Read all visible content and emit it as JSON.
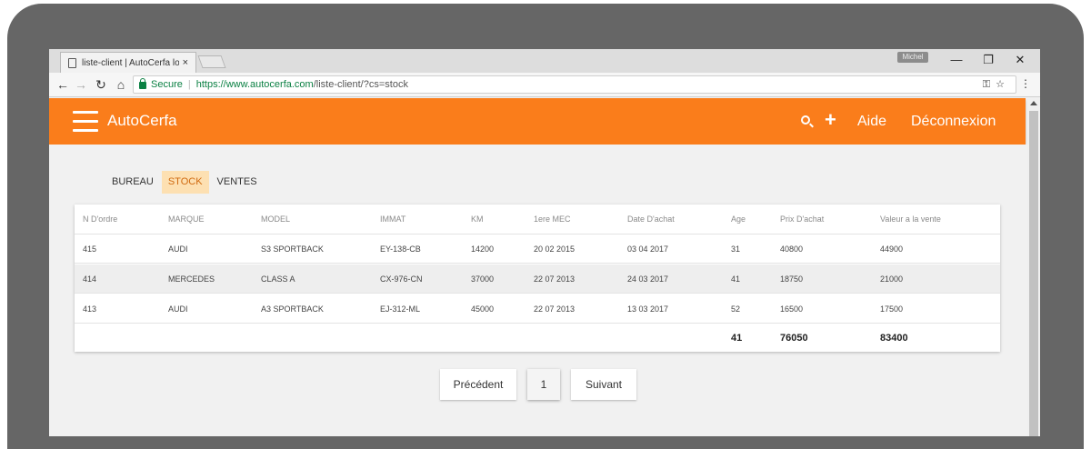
{
  "browser": {
    "tab_title": "liste-client | AutoCerfa lo",
    "tab_close": "×",
    "user_badge": "Michel",
    "min_icon": "—",
    "restore_icon": "❐",
    "close_icon": "✕",
    "secure_label": "Secure",
    "url_base": "https://www.autocerfa.com",
    "url_rest": "/liste-client/?cs=stock",
    "key_icon": "⚿",
    "star_icon": "☆",
    "menu_icon": "⋮"
  },
  "app": {
    "brand": "AutoCerfa",
    "plus": "+",
    "help_label": "Aide",
    "logout_label": "Déconnexion",
    "accent": "#fa7d1b"
  },
  "subtabs": [
    "BUREAU",
    "STOCK",
    "VENTES"
  ],
  "table": {
    "columns": [
      "N D'ordre",
      "MARQUE",
      "MODEL",
      "IMMAT",
      "KM",
      "1ere MEC",
      "Date D'achat",
      "Age",
      "Prix D'achat",
      "Valeur a la vente"
    ],
    "rows": [
      [
        "415",
        "AUDI",
        "S3 SPORTBACK",
        "EY-138-CB",
        "14200",
        "20 02 2015",
        "03 04 2017",
        "31",
        "40800",
        "44900"
      ],
      [
        "414",
        "MERCEDES",
        "CLASS A",
        "CX-976-CN",
        "37000",
        "22 07 2013",
        "24 03 2017",
        "41",
        "18750",
        "21000"
      ],
      [
        "413",
        "AUDI",
        "A3 SPORTBACK",
        "EJ-312-ML",
        "45000",
        "22 07 2013",
        "13 03 2017",
        "52",
        "16500",
        "17500"
      ]
    ],
    "totals": {
      "age": "41",
      "purchase": "76050",
      "sale": "83400"
    }
  },
  "pagination": {
    "prev": "Précédent",
    "current": "1",
    "next": "Suivant"
  }
}
